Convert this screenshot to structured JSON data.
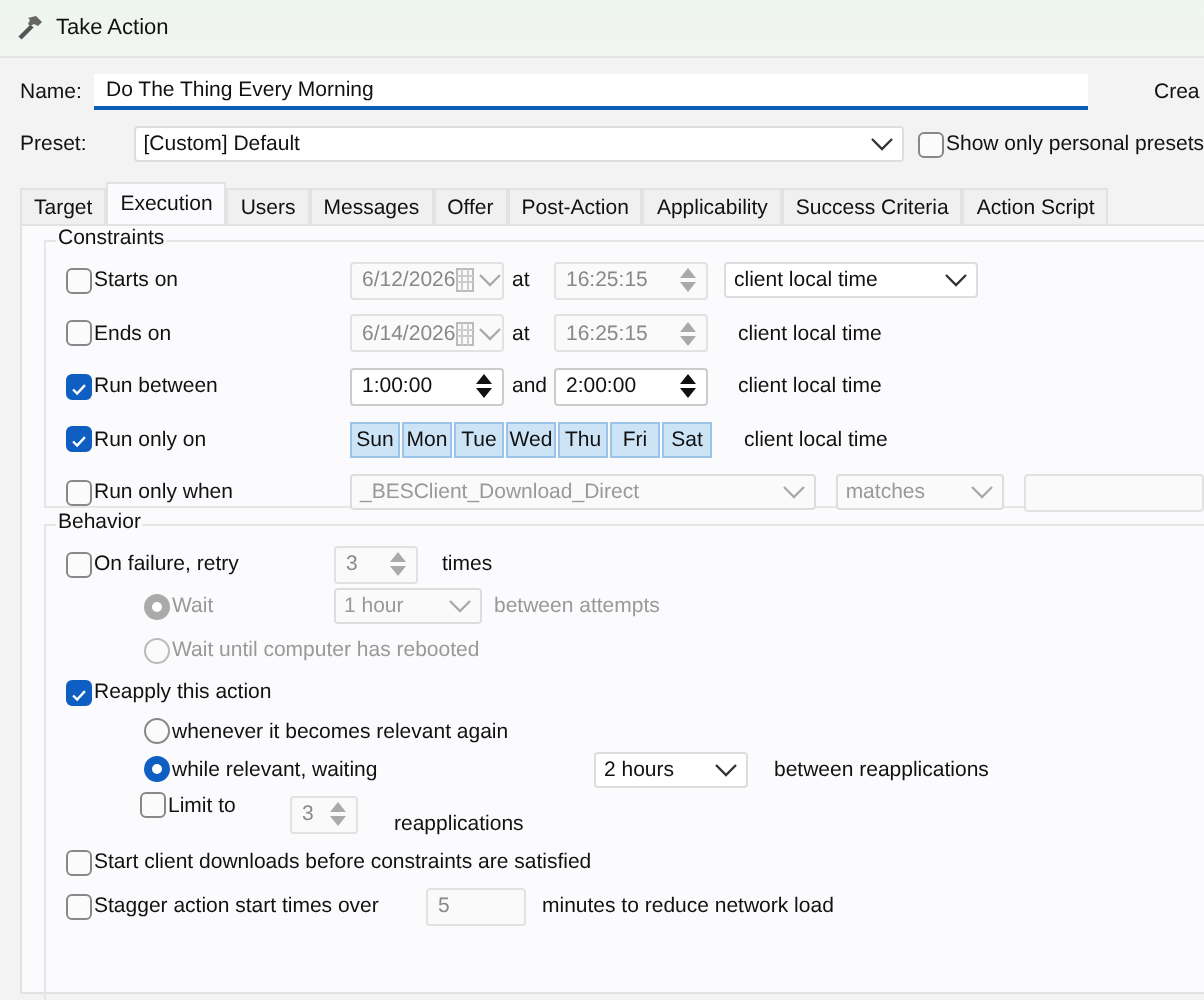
{
  "window": {
    "title": "Take Action"
  },
  "name": {
    "label": "Name:",
    "value": "Do The Thing Every Morning"
  },
  "create_text": "Crea",
  "preset": {
    "label": "Preset:",
    "value": "[Custom] Default",
    "personal": {
      "label": "Show only personal presets",
      "checked": false
    }
  },
  "tabs": [
    {
      "label": "Target",
      "selected": false
    },
    {
      "label": "Execution",
      "selected": true
    },
    {
      "label": "Users",
      "selected": false
    },
    {
      "label": "Messages",
      "selected": false
    },
    {
      "label": "Offer",
      "selected": false
    },
    {
      "label": "Post-Action",
      "selected": false
    },
    {
      "label": "Applicability",
      "selected": false
    },
    {
      "label": "Success Criteria",
      "selected": false
    },
    {
      "label": "Action Script",
      "selected": false
    }
  ],
  "constraints": {
    "title": "Constraints",
    "rows": [
      {
        "kind": "date",
        "label": "Starts on",
        "checked": false,
        "date": "6/12/2026",
        "at": "at",
        "time": "16:25:15",
        "timezone": "client local time",
        "timezone_dropdown": true
      },
      {
        "kind": "date",
        "label": "Ends on",
        "checked": false,
        "date": "6/14/2026",
        "at": "at",
        "time": "16:25:15",
        "timezone": "client local time",
        "timezone_dropdown": false
      },
      {
        "kind": "range",
        "label": "Run between",
        "checked": true,
        "from": "1:00:00",
        "and": "and",
        "to": "2:00:00",
        "timezone": "client local time"
      },
      {
        "kind": "days",
        "label": "Run only on",
        "checked": true,
        "days": [
          {
            "label": "Sun",
            "selected": true
          },
          {
            "label": "Mon",
            "selected": true
          },
          {
            "label": "Tue",
            "selected": true
          },
          {
            "label": "Wed",
            "selected": true
          },
          {
            "label": "Thu",
            "selected": true
          },
          {
            "label": "Fri",
            "selected": true
          },
          {
            "label": "Sat",
            "selected": true
          }
        ],
        "timezone": "client local time"
      },
      {
        "kind": "condition",
        "label": "Run only when",
        "checked": false,
        "property": "_BESClient_Download_Direct",
        "operator": "matches"
      }
    ]
  },
  "behavior": {
    "title": "Behavior",
    "retry": {
      "label": "On failure, retry",
      "checked": false,
      "count": "3",
      "unit": "times",
      "wait": {
        "label": "Wait",
        "selected": true,
        "value": "1 hour",
        "suffix": "between attempts"
      },
      "reboot": {
        "label": "Wait until computer has rebooted",
        "selected": false
      }
    },
    "reapply": {
      "label": "Reapply this action",
      "checked": true,
      "options": [
        {
          "label": "whenever it becomes relevant again",
          "selected": false
        },
        {
          "label": "while relevant, waiting",
          "selected": true,
          "value": "2 hours",
          "suffix": "between reapplications"
        }
      ],
      "limit": {
        "label": "Limit to",
        "checked": false,
        "count": "3",
        "suffix": "reapplications"
      }
    },
    "downloads": {
      "label": "Start client downloads before constraints are satisfied",
      "checked": false
    },
    "stagger": {
      "label": "Stagger action start times over",
      "checked": false,
      "value": "5",
      "suffix": "minutes to reduce network load"
    }
  }
}
